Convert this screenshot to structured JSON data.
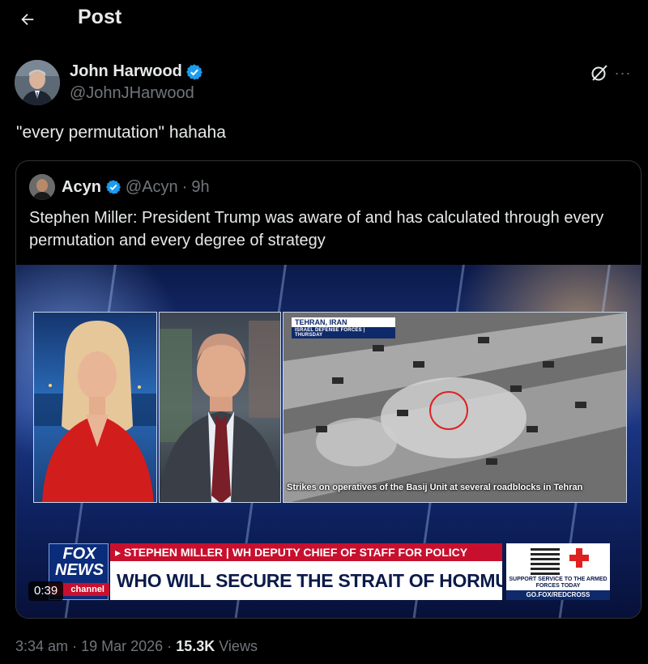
{
  "header": {
    "title": "Post",
    "back_icon": "arrow-left-icon"
  },
  "author": {
    "name": "John Harwood",
    "handle": "@JohnJHarwood",
    "verified_color": "#1d9bf0",
    "grok_icon": "grok-icon",
    "more_icon": "more-dots-icon",
    "more_label": "···"
  },
  "post": {
    "text": "\"every permutation\" hahaha"
  },
  "quote": {
    "name": "Acyn",
    "handle": "@Acyn",
    "separator": "·",
    "time": "9h",
    "text": "Stephen Miller: President Trump was aware of and has calculated through every permutation and every degree of strategy",
    "video": {
      "location": "TEHRAN, IRAN",
      "location_sub": "ISRAEL DEFENSE FORCES | THURSDAY",
      "caption": "Strikes on operatives of the Basij Unit at several roadblocks in Tehran",
      "network_line1": "FOX",
      "network_line2": "NEWS",
      "network_line3": "channel",
      "lower_third_tag": "▸ STEPHEN MILLER | WH DEPUTY CHIEF OF STAFF FOR POLICY",
      "lower_third_headline": "WHO WILL SECURE THE STRAIT OF HORMUZ?",
      "redcross_text": "SUPPORT SERVICE TO THE ARMED FORCES TODAY",
      "redcross_url": "GO.FOX/REDCROSS",
      "duration": "0:39"
    }
  },
  "meta": {
    "time": "3:34 am",
    "sep1": "·",
    "date": "19 Mar 2026",
    "sep2": "·",
    "views": "15.3K",
    "views_label": "Views"
  }
}
